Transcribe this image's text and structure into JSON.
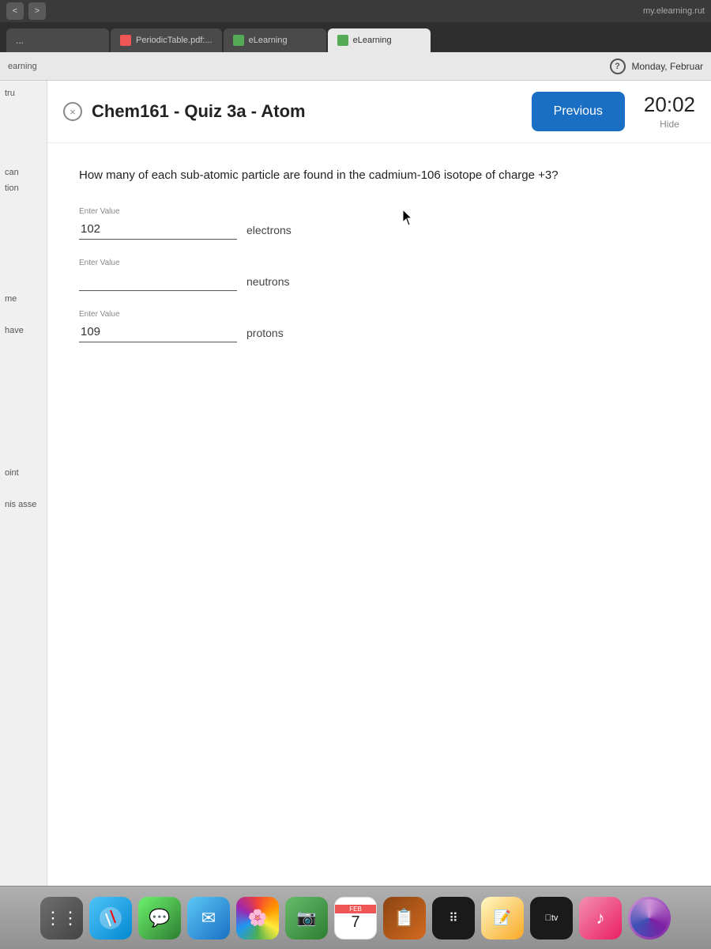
{
  "browser": {
    "domain": "my.elearning.rut",
    "nav_back": "<",
    "nav_forward": ">"
  },
  "tabs": [
    {
      "id": "blank",
      "label": "...",
      "type": "blank"
    },
    {
      "id": "periodic",
      "label": "PeriodicTable.pdf:...",
      "type": "pdf"
    },
    {
      "id": "elearning1",
      "label": "eLearning",
      "type": "elearning"
    },
    {
      "id": "elearning2",
      "label": "eLearning",
      "type": "elearning",
      "active": true
    }
  ],
  "addressbar": {
    "text": "earning",
    "date": "Monday, Februar"
  },
  "question_badge": "?",
  "quiz": {
    "title": "Chem161 - Quiz 3a - Atom",
    "previous_label": "Previous",
    "timer": "20:02",
    "hide_label": "Hide",
    "close_label": "×",
    "question": "How many of each sub-atomic particle are found in the cadmium-106 isotope of charge +3?",
    "fields": [
      {
        "id": "electrons",
        "enter_value_label": "Enter Value",
        "value": "102",
        "particle": "electrons"
      },
      {
        "id": "neutrons",
        "enter_value_label": "Enter Value",
        "value": "",
        "particle": "neutrons"
      },
      {
        "id": "protons",
        "enter_value_label": "Enter Value",
        "value": "109",
        "particle": "protons"
      }
    ]
  },
  "sidebar": {
    "items": [
      "tru",
      "can",
      "tion",
      "me",
      "have",
      "oint",
      "nis asse"
    ]
  },
  "dock": {
    "items": [
      {
        "id": "launchpad",
        "label": "⋮⋮"
      },
      {
        "id": "safari",
        "label": "S"
      },
      {
        "id": "messages",
        "label": "💬"
      },
      {
        "id": "mail",
        "label": "✉"
      },
      {
        "id": "photos",
        "label": "⬡"
      },
      {
        "id": "facetime",
        "label": "📷"
      },
      {
        "id": "calendar",
        "month": "FEB",
        "day": "7"
      },
      {
        "id": "wood",
        "label": ""
      },
      {
        "id": "dots",
        "label": "⠿"
      },
      {
        "id": "notes",
        "label": ""
      },
      {
        "id": "appletv",
        "label": "tv"
      },
      {
        "id": "music",
        "label": "♪"
      },
      {
        "id": "siri",
        "label": ""
      }
    ]
  }
}
